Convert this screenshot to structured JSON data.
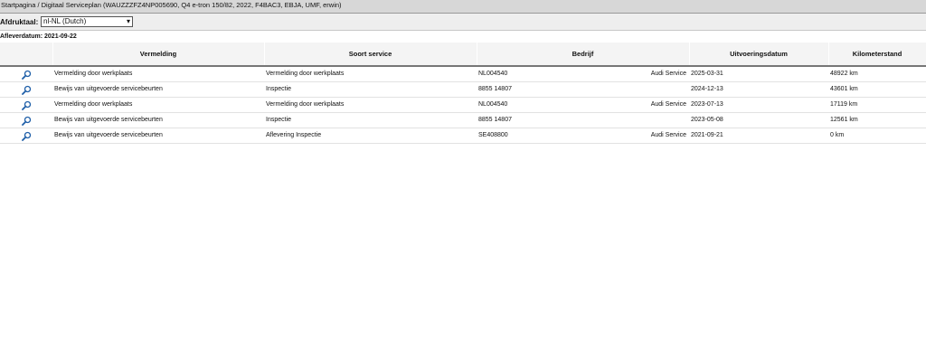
{
  "breadcrumb": "Startpagina / Digitaal Serviceplan (WAUZZZFZ4NP005690, Q4 e-tron 150/82, 2022, F4BAC3, EBJA, UMF, erwin)",
  "print_language": {
    "label": "Afdruktaal:",
    "value": "nl-NL (Dutch)"
  },
  "delivery_date": "Afleverdatum: 2021-09-22",
  "table": {
    "headers": {
      "entry": "Vermelding",
      "service_type": "Soort service",
      "company": "Bedrijf",
      "execution_date": "Uitvoeringsdatum",
      "mileage": "Kilometerstand"
    },
    "rows": [
      {
        "entry": "Vermelding door werkplaats",
        "service_type": "Vermelding door werkplaats",
        "company_code": "NL004540",
        "company_name": "Audi Service",
        "date": "2025-03-31",
        "km": "48922 km"
      },
      {
        "entry": "Bewijs van uitgevoerde servicebeurten",
        "service_type": "Inspectie",
        "company_code": "8855 14807",
        "company_name": "",
        "date": "2024-12-13",
        "km": "43601 km"
      },
      {
        "entry": "Vermelding door werkplaats",
        "service_type": "Vermelding door werkplaats",
        "company_code": "NL004540",
        "company_name": "Audi Service",
        "date": "2023-07-13",
        "km": "17119 km"
      },
      {
        "entry": "Bewijs van uitgevoerde servicebeurten",
        "service_type": "Inspectie",
        "company_code": "8855 14807",
        "company_name": "",
        "date": "2023-05-08",
        "km": "12561 km"
      },
      {
        "entry": "Bewijs van uitgevoerde servicebeurten",
        "service_type": "Aflevering Inspectie",
        "company_code": "SE408800",
        "company_name": "Audi Service",
        "date": "2021-09-21",
        "km": "0 km"
      }
    ]
  },
  "icons": {
    "row_detail": "magnifier-icon",
    "select_arrow": "chevron-down-icon"
  },
  "colors": {
    "icon_blue": "#1f5fa8"
  }
}
